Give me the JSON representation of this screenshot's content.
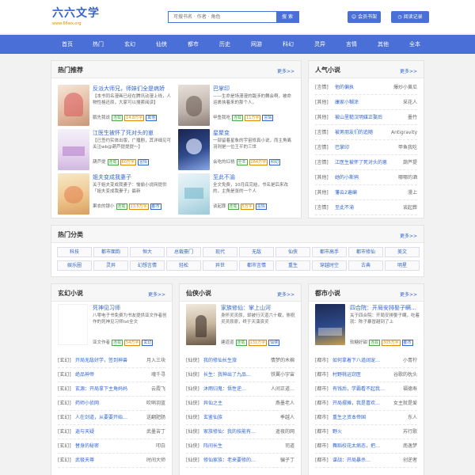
{
  "header": {
    "logo": "六六文学",
    "logo_sub": "www.66wx.org",
    "search_placeholder": "可搜书名 · 作者 · 角色",
    "search_button": "搜 索",
    "member_button": "会员书架",
    "history_button": "阅读记录"
  },
  "nav": [
    "首页",
    "热门",
    "玄幻",
    "仙侠",
    "都市",
    "历史",
    "网游",
    "科幻",
    "灵异",
    "言情",
    "其他",
    "全本"
  ],
  "hot": {
    "title": "热门推荐",
    "more": "更多>>",
    "books": [
      {
        "title": "反派大师兄，师妹们全是病娇",
        "desc": "【本书同名漫画已经在腾讯动漫上线，人物性格还原，大家可以搜索阅读】",
        "author": "鹅先我说",
        "tags": [
          "连载",
          "14.8万字",
          "其他"
        ]
      },
      {
        "title": "巴掌印",
        "desc": "——生命是场漫漫的跋涉的舞会啊，被命运裹挟着来的那个人，",
        "author": "甲鱼我吃",
        "tags": [
          "连载",
          "11万字",
          "言情"
        ]
      },
      {
        "title": "江医生被怀了死对头的崽",
        "desc": "【已签约实体出版，广播剧，其详细见可关注wb@葫芦提提提～】",
        "author": "葫芦提",
        "tags": [
          "连载",
          "60万字",
          "言情"
        ]
      },
      {
        "title": "星聚变",
        "desc": "一部留着星象的宇宙修真小说，而主角离羽则是一位王平的三世",
        "author": "会吃的红桃",
        "tags": [
          "全本",
          "264万字",
          "科幻"
        ]
      },
      {
        "title": "姐夫变成我妻子",
        "desc": "关于姐夫变成我妻子：愉偷小说网提供「姐夫变成我妻子」最新",
        "author": "果衣的银小",
        "tags": [
          "连载",
          "13.5万字",
          "都市"
        ]
      },
      {
        "title": "至此不渝",
        "desc": "全文免费，10月底完结，书名是后来改的，主角是张的一个人",
        "author": "谈起葬",
        "tags": [
          "连载",
          "5万字",
          "言情"
        ]
      }
    ]
  },
  "popular": {
    "title": "人气小说",
    "more": "更多>>",
    "items": [
      {
        "cat": "[言情]",
        "name": "他的偏执",
        "author": "爆炒小黄瓜"
      },
      {
        "cat": "[其他]",
        "name": "康家小糊涂",
        "author": "采花人"
      },
      {
        "cat": "[其他]",
        "name": "被山里糙汉明媒正娶后",
        "author": "墨竹"
      },
      {
        "cat": "[言情]",
        "name": "被男朋友们的追随",
        "author": "Antigravity"
      },
      {
        "cat": "[言情]",
        "name": "巴掌印",
        "author": "甲鱼我吃"
      },
      {
        "cat": "[言情]",
        "name": "江医生被怀了死对头的崽",
        "author": "葫芦提"
      },
      {
        "cat": "[其他]",
        "name": "她的小斯鸦",
        "author": "哪哪的酒"
      },
      {
        "cat": "[其他]",
        "name": "藩云2遍编",
        "author": "漫上"
      },
      {
        "cat": "[言情]",
        "name": "至此不渝",
        "author": "谈起葬"
      }
    ]
  },
  "categories": {
    "title": "热门分类",
    "more": "更多>>",
    "row1": [
      "科技",
      "都市面韵",
      "恒大",
      "总裁豪门",
      "现代",
      "无敌",
      "仙侠",
      "都市高手",
      "都市修仙",
      "美文"
    ],
    "row2": [
      "娱乐圈",
      "灵异",
      "幻想言情",
      "轻松",
      "异世",
      "都市言情",
      "重生",
      "穿越时空",
      "古典",
      "明星"
    ]
  },
  "sections": [
    {
      "title": "玄幻小说",
      "more": "更多>>",
      "feature": {
        "title": "死神见习师",
        "desc": "八零电子书免费为书友提供亚文作者创作的死神见习师txt全文",
        "author": "亚文作者",
        "tags": [
          "连载",
          "54万字",
          "玄幻"
        ]
      },
      "items": [
        {
          "cat": "[玄幻]",
          "name": "开局无敌好学，签到神兽",
          "author": "月入三块"
        },
        {
          "cat": "[玄幻]",
          "name": "绝品神帝",
          "author": "魂千寻"
        },
        {
          "cat": "[玄幻]",
          "name": "玄源：开局拿下主角妈妈",
          "author": "云霞飞"
        },
        {
          "cat": "[玄幻]",
          "name": "药师小侦网",
          "author": "吹哨羽蓝"
        },
        {
          "cat": "[玄幻]",
          "name": "人在剑道，从要要开始…",
          "author": "送翻肥肠"
        },
        {
          "cat": "[玄幻]",
          "name": "逍与天疑",
          "author": "武墨苦丁"
        },
        {
          "cat": "[玄幻]",
          "name": "替身的秘密",
          "author": "叩白"
        },
        {
          "cat": "[玄幻]",
          "name": "武极天尊",
          "author": "时间大师"
        }
      ]
    },
    {
      "title": "仙侠小说",
      "more": "更多>>",
      "feature": {
        "title": "家族修仙：掌上山河",
        "desc": "身怀灵灵原，却被行灭道六十载，侧祝灵灵原原，终于天演资灵",
        "author": "建道道",
        "tags": [
          "连载",
          "131万字",
          "仙侠"
        ]
      },
      "items": [
        {
          "cat": "[仙侠]",
          "name": "我的修仙长生旅",
          "author": "情梦的木棉"
        },
        {
          "cat": "[仙侠]",
          "name": "长生：我神出了九品…",
          "author": "铁翼小宇宙"
        },
        {
          "cat": "[仙侠]",
          "name": "沐雨归鬼：悟性逆…",
          "author": "人间正道…"
        },
        {
          "cat": "[仙侠]",
          "name": "异仙之主",
          "author": "燕墨老人"
        },
        {
          "cat": "[仙侠]",
          "name": "玄鉴仙族",
          "author": "季越人"
        },
        {
          "cat": "[仙侠]",
          "name": "家族修仙：我的技能有…",
          "author": "遥夜的网"
        },
        {
          "cat": "[仙侠]",
          "name": "阵间长生",
          "author": "司道"
        },
        {
          "cat": "[仙侠]",
          "name": "修仙家族：老来要修的…",
          "author": "骗子丁"
        }
      ]
    },
    {
      "title": "都市小说",
      "more": "更多>>",
      "feature": {
        "title": "四合院：开局安排娶子瞒…",
        "desc": "关于四合院：开局安排娶子瞒，吃着就：陈子暴冒越到了上",
        "author": "软糖好甜",
        "tags": [
          "连载",
          "305万字",
          "都市"
        ]
      },
      "items": [
        {
          "cat": "[都市]",
          "name": "如何拿着下八道阔宠…",
          "author": "小青柠"
        },
        {
          "cat": "[都市]",
          "name": "村野桃运窃医",
          "author": "谷歌的枕头"
        },
        {
          "cat": "[都市]",
          "name": "有钱后，学霸看不起我…",
          "author": "福德寿"
        },
        {
          "cat": "[都市]",
          "name": "开局摆摊，我是喜欢…",
          "author": "女主就是爱"
        },
        {
          "cat": "[都市]",
          "name": "重生之资本帝国",
          "author": "东人"
        },
        {
          "cat": "[都市]",
          "name": "野火",
          "author": "苏行歌"
        },
        {
          "cat": "[都市]",
          "name": "舞蹈校花太病态，把…",
          "author": "南逸梦"
        },
        {
          "cat": "[都市]",
          "name": "谍战：开局暴杀…",
          "author": "创逆者"
        }
      ]
    }
  ],
  "colors": {
    "accent": "#4a6fd6",
    "link": "#3366cc",
    "orange": "#e08a00",
    "green": "#4aa84a"
  }
}
